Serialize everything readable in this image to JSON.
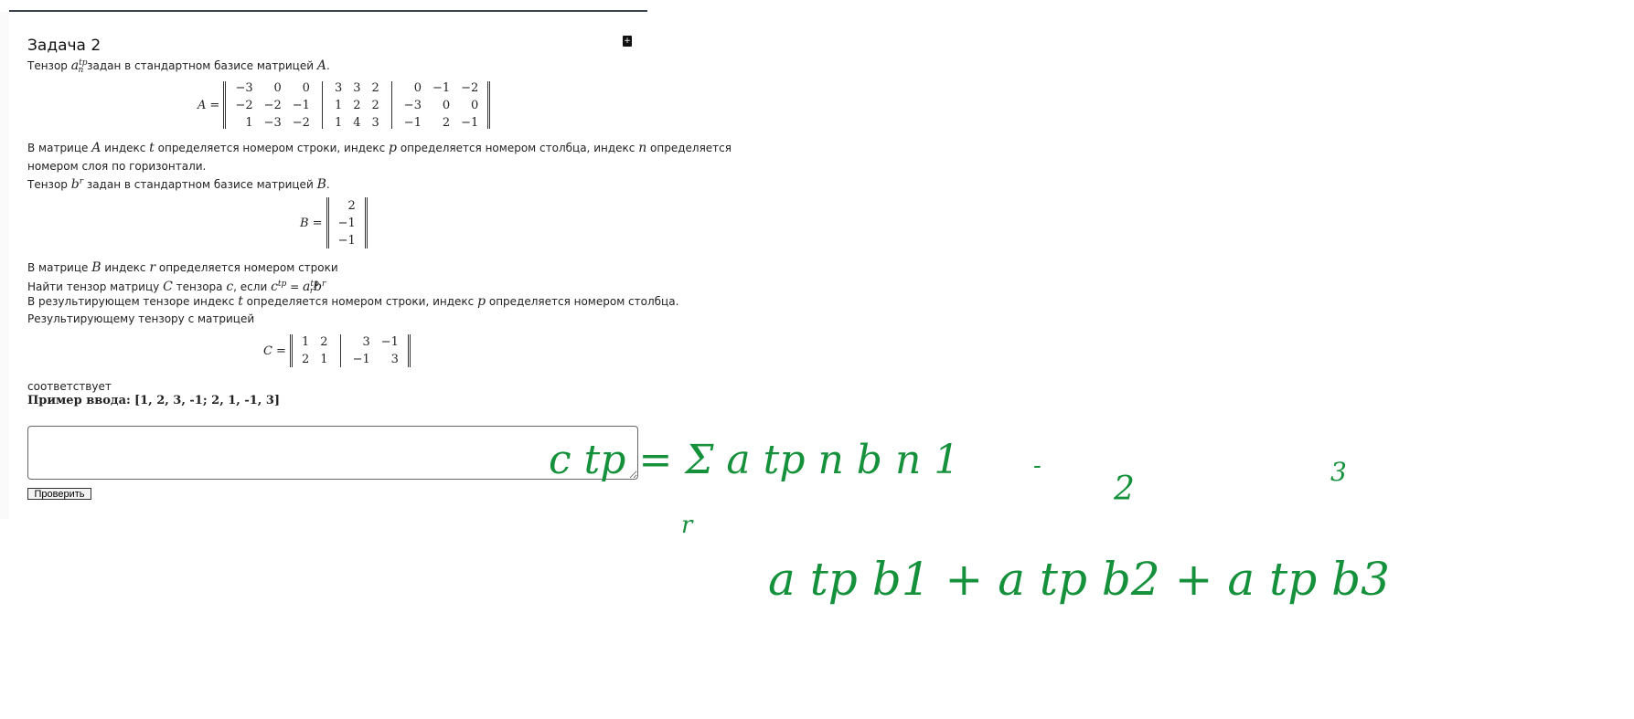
{
  "task": {
    "title": "Задача 2",
    "p1": [
      "Тензор ",
      "a",
      "tp",
      "n",
      " задан в стандартном базисе матрицей ",
      "A",
      "."
    ],
    "matrixA": {
      "label": "A",
      "blocks": [
        [
          [
            "−3",
            "0",
            "0"
          ],
          [
            "−2",
            "−2",
            "−1"
          ],
          [
            "1",
            "−3",
            "−2"
          ]
        ],
        [
          [
            "3",
            "3",
            "2"
          ],
          [
            "1",
            "2",
            "2"
          ],
          [
            "1",
            "4",
            "3"
          ]
        ],
        [
          [
            "0",
            "−1",
            "−2"
          ],
          [
            "−3",
            "0",
            "0"
          ],
          [
            "−1",
            "2",
            "−1"
          ]
        ]
      ]
    },
    "p2a": [
      "В матрице ",
      "A",
      " индекс ",
      "t",
      " определяется номером строки, индекс ",
      "p",
      " определяется номером столбца, индекс ",
      "n",
      " определяется"
    ],
    "p2b": "номером слоя по горизонтали.",
    "p3": [
      "Тензор ",
      "b",
      "r",
      " задан в стандартном базисе матрицей ",
      "B",
      "."
    ],
    "matrixB": {
      "label": "B",
      "values": [
        "2",
        "−1",
        "−1"
      ]
    },
    "p4": [
      "В матрице ",
      "B",
      " индекс ",
      "r",
      " определяется номером строки"
    ],
    "p5": [
      "Найти тензор матрицу ",
      "C",
      " тензора ",
      "c",
      ", если ",
      "c",
      "tp",
      " = ",
      "a",
      "tp",
      "r",
      "b",
      "r"
    ],
    "p6": [
      "В результирующем тензоре индекс ",
      "t",
      " определяется номером строки, индекс ",
      "p",
      " определяется номером столбца."
    ],
    "p7": "Результирующему тензору с матрицей",
    "matrixC": {
      "label": "C",
      "blocks": [
        [
          [
            "1",
            "2"
          ],
          [
            "2",
            "1"
          ]
        ],
        [
          [
            "3",
            "−1"
          ],
          [
            "−1",
            "3"
          ]
        ]
      ]
    },
    "p8": "соответствует",
    "example_label": "Пример ввода:",
    "example_value": "[1, 2, 3, -1; 2, 1, -1, 3]",
    "answer_value": "",
    "check_button": "Проверить"
  },
  "handwriting": {
    "line1": "c tp = Σ a tp n b n 1",
    "sum_index": "r",
    "dash": "-",
    "two": "2",
    "three": "3",
    "line2": "a tp b1 + a tp b2 + a tp b3"
  },
  "colors": {
    "ink": "#14913a"
  }
}
